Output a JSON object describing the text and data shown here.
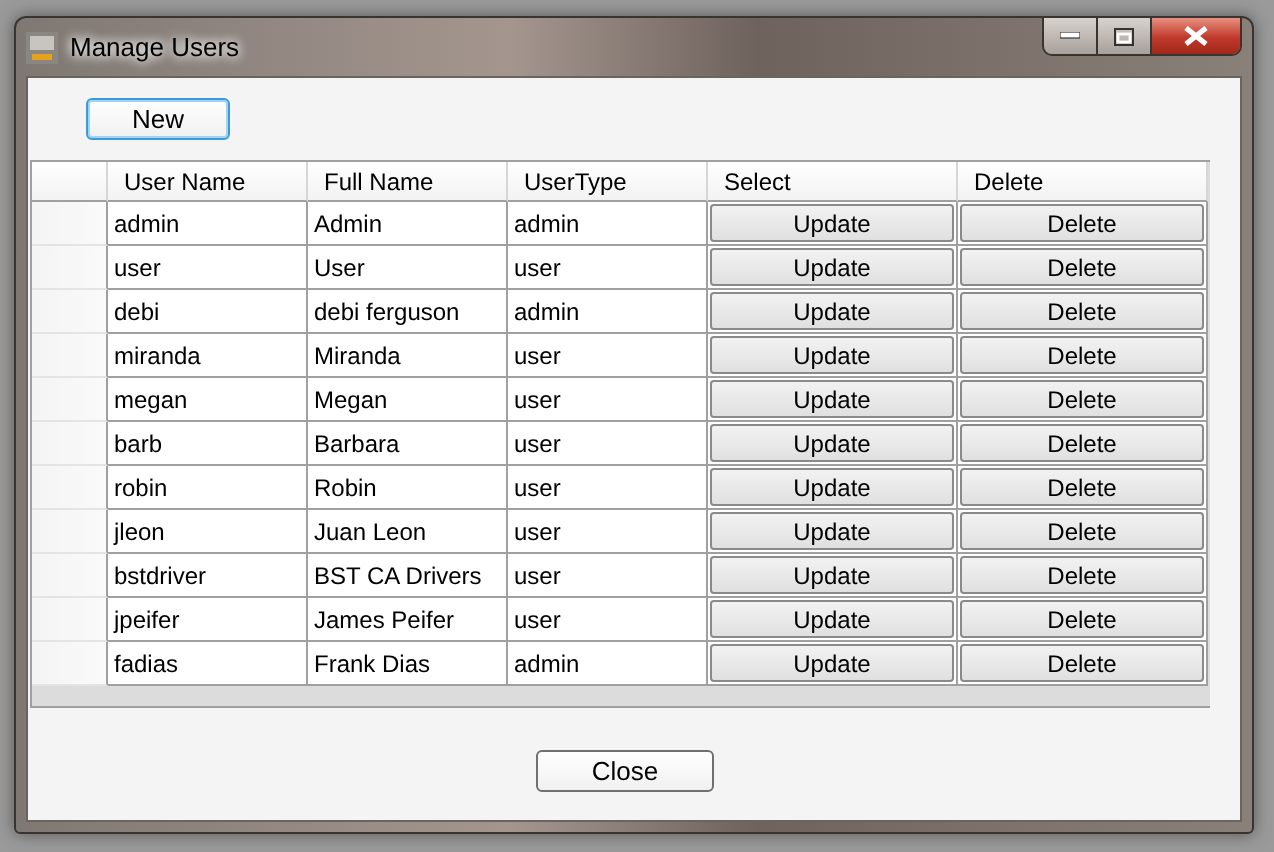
{
  "window": {
    "title": "Manage Users"
  },
  "new_button": "New",
  "table": {
    "columns": [
      "User Name",
      "Full Name",
      "UserType",
      "Select",
      "Delete"
    ],
    "rows": [
      {
        "user_name": "admin",
        "full_name": "Admin",
        "user_type": "admin",
        "select": "Update",
        "delete": "Delete"
      },
      {
        "user_name": "user",
        "full_name": "User",
        "user_type": "user",
        "select": "Update",
        "delete": "Delete"
      },
      {
        "user_name": "debi",
        "full_name": "debi ferguson",
        "user_type": "admin",
        "select": "Update",
        "delete": "Delete"
      },
      {
        "user_name": "miranda",
        "full_name": "Miranda",
        "user_type": "user",
        "select": "Update",
        "delete": "Delete"
      },
      {
        "user_name": "megan",
        "full_name": "Megan",
        "user_type": "user",
        "select": "Update",
        "delete": "Delete"
      },
      {
        "user_name": "barb",
        "full_name": "Barbara",
        "user_type": "user",
        "select": "Update",
        "delete": "Delete"
      },
      {
        "user_name": "robin",
        "full_name": "Robin",
        "user_type": "user",
        "select": "Update",
        "delete": "Delete"
      },
      {
        "user_name": "jleon",
        "full_name": "Juan Leon",
        "user_type": "user",
        "select": "Update",
        "delete": "Delete"
      },
      {
        "user_name": "bstdriver",
        "full_name": "BST CA Drivers",
        "user_type": "user",
        "select": "Update",
        "delete": "Delete"
      },
      {
        "user_name": "jpeifer",
        "full_name": "James Peifer",
        "user_type": "user",
        "select": "Update",
        "delete": "Delete"
      },
      {
        "user_name": "fadias",
        "full_name": "Frank Dias",
        "user_type": "admin",
        "select": "Update",
        "delete": "Delete"
      }
    ]
  },
  "close_button": "Close"
}
